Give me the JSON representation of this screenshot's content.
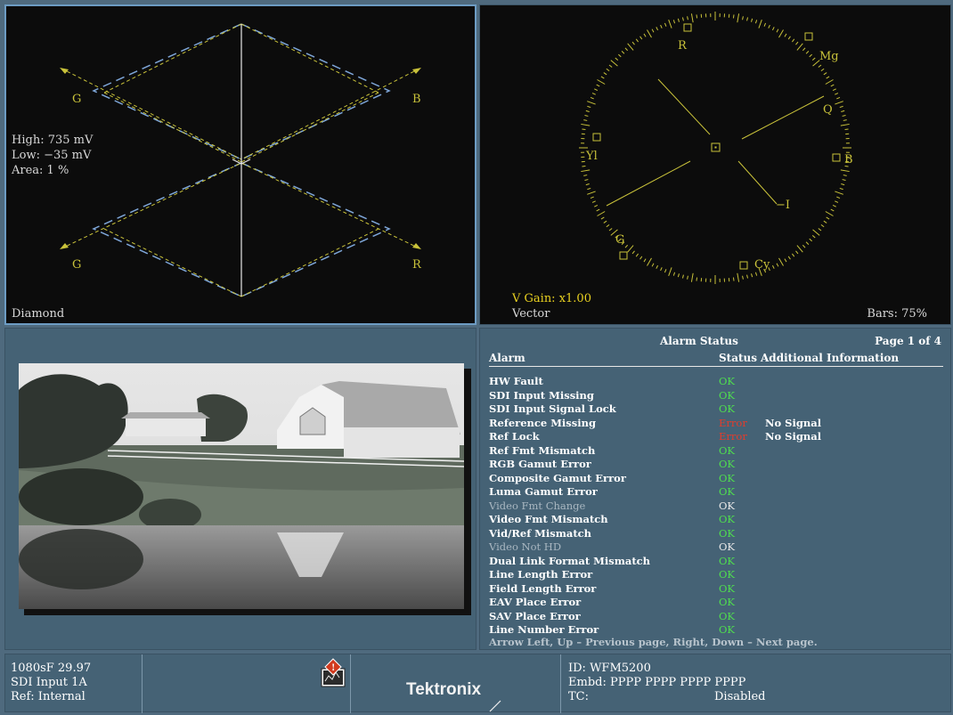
{
  "diamond": {
    "label": "Diamond",
    "readout": {
      "high": "High: 735 mV",
      "low": "Low: −35 mV",
      "area": "Area:   1 %"
    },
    "axis_labels": {
      "top_left": "G",
      "top_right": "B",
      "bottom_left": "G",
      "bottom_right": "R"
    }
  },
  "vector": {
    "label": "Vector",
    "gain": "V Gain: x1.00",
    "bars": "Bars: 75%",
    "targets": {
      "r": "R",
      "mg": "Mg",
      "yl": "Yl",
      "b": "B",
      "q": "Q",
      "minus_i": "−I",
      "g": "G",
      "cy": "Cy"
    }
  },
  "alarm_status": {
    "title": "Alarm Status",
    "page": "Page 1 of 4",
    "columns": {
      "alarm": "Alarm",
      "status": "Status",
      "info": "Additional Information"
    },
    "rows": [
      {
        "name": "HW Fault",
        "status": "OK",
        "info": ""
      },
      {
        "name": "SDI Input Missing",
        "status": "OK",
        "info": ""
      },
      {
        "name": "SDI Input Signal Lock",
        "status": "OK",
        "info": ""
      },
      {
        "name": "Reference Missing",
        "status": "Error",
        "info": "No Signal"
      },
      {
        "name": "Ref Lock",
        "status": "Error",
        "info": "No Signal"
      },
      {
        "name": "Ref Fmt Mismatch",
        "status": "OK",
        "info": ""
      },
      {
        "name": "RGB Gamut Error",
        "status": "OK",
        "info": ""
      },
      {
        "name": "Composite Gamut Error",
        "status": "OK",
        "info": ""
      },
      {
        "name": "Luma Gamut Error",
        "status": "OK",
        "info": ""
      },
      {
        "name": "Video Fmt Change",
        "status": "OK",
        "info": ""
      },
      {
        "name": "Video Fmt Mismatch",
        "status": "OK",
        "info": ""
      },
      {
        "name": "Vid/Ref Mismatch",
        "status": "OK",
        "info": ""
      },
      {
        "name": "Video Not HD",
        "status": "OK",
        "info": ""
      },
      {
        "name": "Dual Link Format Mismatch",
        "status": "OK",
        "info": ""
      },
      {
        "name": "Line Length Error",
        "status": "OK",
        "info": ""
      },
      {
        "name": "Field Length Error",
        "status": "OK",
        "info": ""
      },
      {
        "name": "EAV Place Error",
        "status": "OK",
        "info": ""
      },
      {
        "name": "SAV Place Error",
        "status": "OK",
        "info": ""
      },
      {
        "name": "Line Number Error",
        "status": "OK",
        "info": ""
      }
    ],
    "footer": "Arrow Left, Up – Previous page, Right, Down – Next page."
  },
  "status_bar": {
    "format": "1080sF 29.97",
    "input": "SDI Input 1A",
    "ref": "Ref: Internal",
    "brand": "Tektronix",
    "alarm_icon": "warning-alarm-icon",
    "id": "ID: WFM5200",
    "embd": "Embd: PPPP PPPP PPPP PPPP",
    "tc_label": "TC:",
    "tc_value": "Disabled"
  },
  "colors": {
    "trace_yellow": "#c9c23a",
    "trace_blue": "#7ea6d8",
    "ok_green": "#4fdc4f",
    "error_red": "#e43c2c",
    "panel_blue": "#456275"
  }
}
